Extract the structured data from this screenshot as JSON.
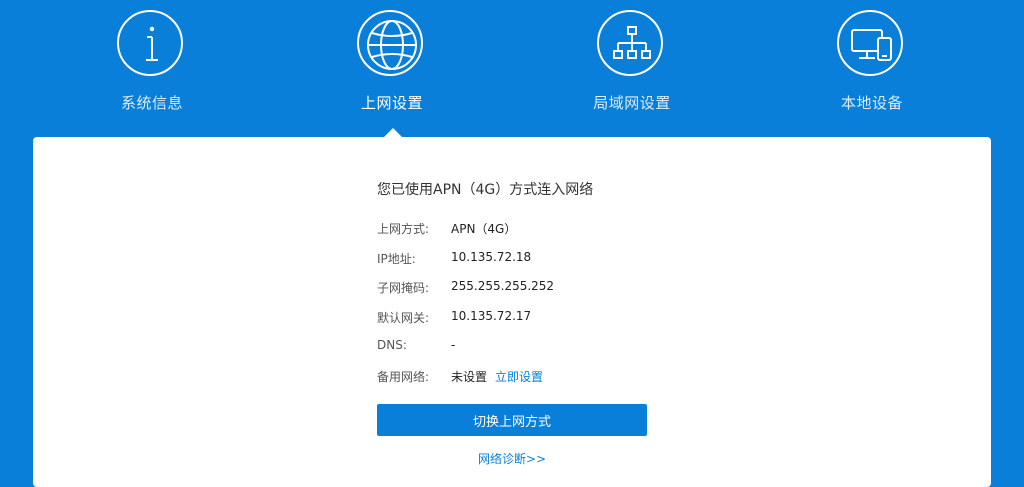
{
  "nav": {
    "items": [
      {
        "label": "系统信息",
        "icon": "info-icon"
      },
      {
        "label": "上网设置",
        "icon": "globe-icon"
      },
      {
        "label": "局域网设置",
        "icon": "network-tree-icon"
      },
      {
        "label": "本地设备",
        "icon": "devices-icon"
      }
    ],
    "active_index": 1
  },
  "status": {
    "title": "您已使用APN（4G）方式连入网络"
  },
  "info": {
    "mode": {
      "label": "上网方式:",
      "value": "APN（4G）"
    },
    "ip": {
      "label": "IP地址:",
      "value": "10.135.72.18"
    },
    "mask": {
      "label": "子网掩码:",
      "value": "255.255.255.252"
    },
    "gateway": {
      "label": "默认网关:",
      "value": "10.135.72.17"
    },
    "dns": {
      "label": "DNS:",
      "value": "-"
    },
    "backup": {
      "label": "备用网络:",
      "value": "未设置",
      "link": "立即设置"
    }
  },
  "actions": {
    "switch_button": "切换上网方式",
    "diagnose_link": "网络诊断>>"
  },
  "colors": {
    "brand": "#0a7fd9",
    "panel": "#ffffff"
  }
}
